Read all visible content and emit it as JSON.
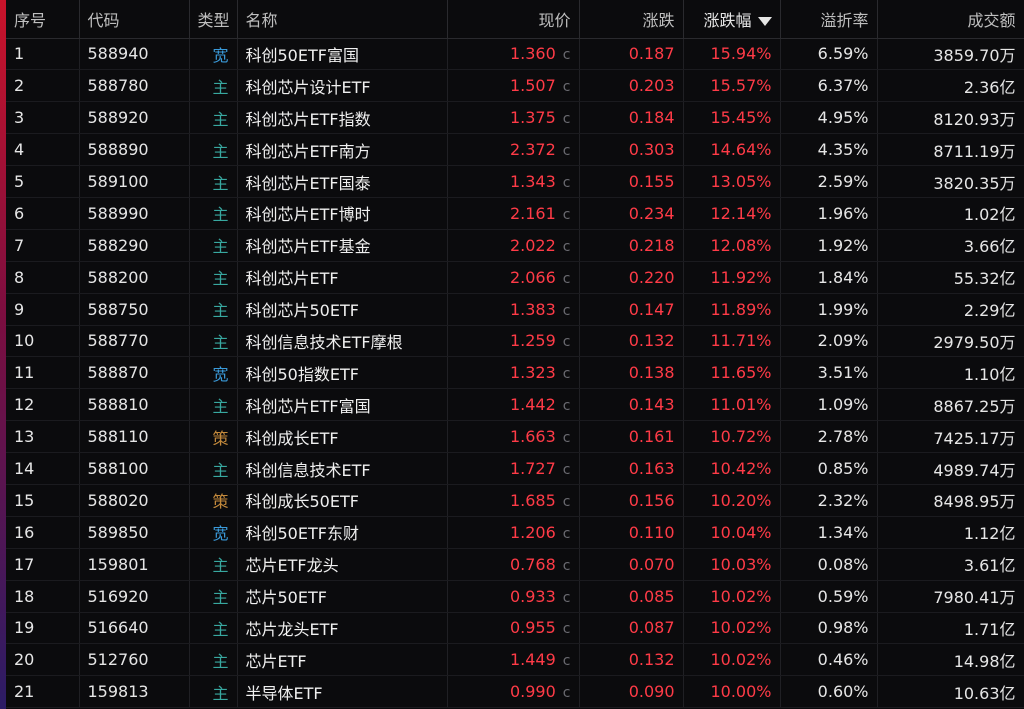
{
  "header": {
    "index": "序号",
    "code": "代码",
    "type": "类型",
    "name": "名称",
    "price": "现价",
    "change": "涨跌",
    "change_pct": "涨跌幅",
    "premium": "溢折率",
    "amount": "成交额"
  },
  "colors": {
    "up": "#ff3b47",
    "type_broad": "#3a9ad9",
    "type_main": "#38a8a0",
    "type_strategy": "#c48a3c",
    "background": "#0b0b0d"
  },
  "rows": [
    {
      "index": "1",
      "code": "588940",
      "type": "宽",
      "type_kind": "broad",
      "name": "科创50ETF富国",
      "price": "1.360",
      "flag": "c",
      "change": "0.187",
      "change_pct": "15.94%",
      "premium": "6.59%",
      "amount": "3859.70万"
    },
    {
      "index": "2",
      "code": "588780",
      "type": "主",
      "type_kind": "main",
      "name": "科创芯片设计ETF",
      "price": "1.507",
      "flag": "c",
      "change": "0.203",
      "change_pct": "15.57%",
      "premium": "6.37%",
      "amount": "2.36亿"
    },
    {
      "index": "3",
      "code": "588920",
      "type": "主",
      "type_kind": "main",
      "name": "科创芯片ETF指数",
      "price": "1.375",
      "flag": "c",
      "change": "0.184",
      "change_pct": "15.45%",
      "premium": "4.95%",
      "amount": "8120.93万"
    },
    {
      "index": "4",
      "code": "588890",
      "type": "主",
      "type_kind": "main",
      "name": "科创芯片ETF南方",
      "price": "2.372",
      "flag": "c",
      "change": "0.303",
      "change_pct": "14.64%",
      "premium": "4.35%",
      "amount": "8711.19万"
    },
    {
      "index": "5",
      "code": "589100",
      "type": "主",
      "type_kind": "main",
      "name": "科创芯片ETF国泰",
      "price": "1.343",
      "flag": "c",
      "change": "0.155",
      "change_pct": "13.05%",
      "premium": "2.59%",
      "amount": "3820.35万"
    },
    {
      "index": "6",
      "code": "588990",
      "type": "主",
      "type_kind": "main",
      "name": "科创芯片ETF博时",
      "price": "2.161",
      "flag": "c",
      "change": "0.234",
      "change_pct": "12.14%",
      "premium": "1.96%",
      "amount": "1.02亿"
    },
    {
      "index": "7",
      "code": "588290",
      "type": "主",
      "type_kind": "main",
      "name": "科创芯片ETF基金",
      "price": "2.022",
      "flag": "c",
      "change": "0.218",
      "change_pct": "12.08%",
      "premium": "1.92%",
      "amount": "3.66亿"
    },
    {
      "index": "8",
      "code": "588200",
      "type": "主",
      "type_kind": "main",
      "name": "科创芯片ETF",
      "price": "2.066",
      "flag": "c",
      "change": "0.220",
      "change_pct": "11.92%",
      "premium": "1.84%",
      "amount": "55.32亿"
    },
    {
      "index": "9",
      "code": "588750",
      "type": "主",
      "type_kind": "main",
      "name": "科创芯片50ETF",
      "price": "1.383",
      "flag": "c",
      "change": "0.147",
      "change_pct": "11.89%",
      "premium": "1.99%",
      "amount": "2.29亿"
    },
    {
      "index": "10",
      "code": "588770",
      "type": "主",
      "type_kind": "main",
      "name": "科创信息技术ETF摩根",
      "price": "1.259",
      "flag": "c",
      "change": "0.132",
      "change_pct": "11.71%",
      "premium": "2.09%",
      "amount": "2979.50万"
    },
    {
      "index": "11",
      "code": "588870",
      "type": "宽",
      "type_kind": "broad",
      "name": "科创50指数ETF",
      "price": "1.323",
      "flag": "c",
      "change": "0.138",
      "change_pct": "11.65%",
      "premium": "3.51%",
      "amount": "1.10亿"
    },
    {
      "index": "12",
      "code": "588810",
      "type": "主",
      "type_kind": "main",
      "name": "科创芯片ETF富国",
      "price": "1.442",
      "flag": "c",
      "change": "0.143",
      "change_pct": "11.01%",
      "premium": "1.09%",
      "amount": "8867.25万"
    },
    {
      "index": "13",
      "code": "588110",
      "type": "策",
      "type_kind": "strategy",
      "name": "科创成长ETF",
      "price": "1.663",
      "flag": "c",
      "change": "0.161",
      "change_pct": "10.72%",
      "premium": "2.78%",
      "amount": "7425.17万"
    },
    {
      "index": "14",
      "code": "588100",
      "type": "主",
      "type_kind": "main",
      "name": "科创信息技术ETF",
      "price": "1.727",
      "flag": "c",
      "change": "0.163",
      "change_pct": "10.42%",
      "premium": "0.85%",
      "amount": "4989.74万"
    },
    {
      "index": "15",
      "code": "588020",
      "type": "策",
      "type_kind": "strategy",
      "name": "科创成长50ETF",
      "price": "1.685",
      "flag": "c",
      "change": "0.156",
      "change_pct": "10.20%",
      "premium": "2.32%",
      "amount": "8498.95万"
    },
    {
      "index": "16",
      "code": "589850",
      "type": "宽",
      "type_kind": "broad",
      "name": "科创50ETF东财",
      "price": "1.206",
      "flag": "c",
      "change": "0.110",
      "change_pct": "10.04%",
      "premium": "1.34%",
      "amount": "1.12亿"
    },
    {
      "index": "17",
      "code": "159801",
      "type": "主",
      "type_kind": "main",
      "name": "芯片ETF龙头",
      "price": "0.768",
      "flag": "c",
      "change": "0.070",
      "change_pct": "10.03%",
      "premium": "0.08%",
      "amount": "3.61亿"
    },
    {
      "index": "18",
      "code": "516920",
      "type": "主",
      "type_kind": "main",
      "name": "芯片50ETF",
      "price": "0.933",
      "flag": "c",
      "change": "0.085",
      "change_pct": "10.02%",
      "premium": "0.59%",
      "amount": "7980.41万"
    },
    {
      "index": "19",
      "code": "516640",
      "type": "主",
      "type_kind": "main",
      "name": "芯片龙头ETF",
      "price": "0.955",
      "flag": "c",
      "change": "0.087",
      "change_pct": "10.02%",
      "premium": "0.98%",
      "amount": "1.71亿"
    },
    {
      "index": "20",
      "code": "512760",
      "type": "主",
      "type_kind": "main",
      "name": "芯片ETF",
      "price": "1.449",
      "flag": "c",
      "change": "0.132",
      "change_pct": "10.02%",
      "premium": "0.46%",
      "amount": "14.98亿"
    },
    {
      "index": "21",
      "code": "159813",
      "type": "主",
      "type_kind": "main",
      "name": "半导体ETF",
      "price": "0.990",
      "flag": "c",
      "change": "0.090",
      "change_pct": "10.00%",
      "premium": "0.60%",
      "amount": "10.63亿"
    }
  ]
}
